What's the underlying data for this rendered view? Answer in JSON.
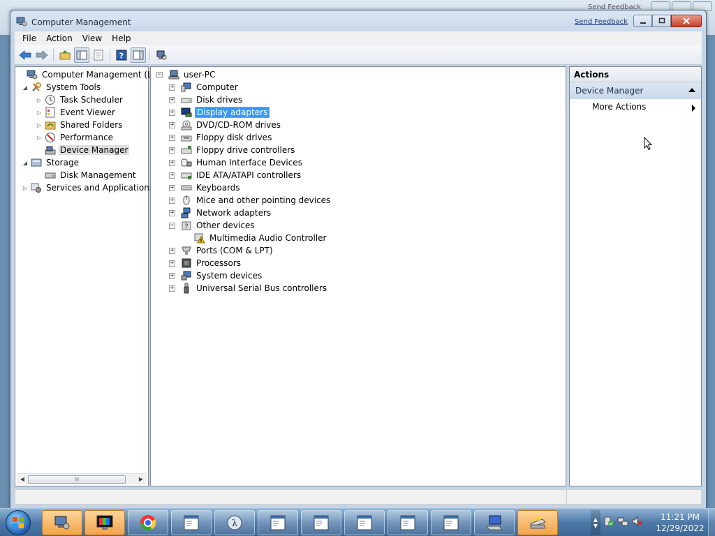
{
  "background_window": {
    "feedback": "Send Feedback"
  },
  "window": {
    "title": "Computer Management",
    "send_feedback": "Send Feedback"
  },
  "menu": [
    "File",
    "Action",
    "View",
    "Help"
  ],
  "left_tree": {
    "root": "Computer Management (Local",
    "system_tools": "System Tools",
    "task_scheduler": "Task Scheduler",
    "event_viewer": "Event Viewer",
    "shared_folders": "Shared Folders",
    "performance": "Performance",
    "device_manager": "Device Manager",
    "storage": "Storage",
    "disk_management": "Disk Management",
    "services": "Services and Applications",
    "scroll_thumb": "III"
  },
  "device_tree": {
    "root": "user-PC",
    "items": [
      "Computer",
      "Disk drives",
      "Display adapters",
      "DVD/CD-ROM drives",
      "Floppy disk drives",
      "Floppy drive controllers",
      "Human Interface Devices",
      "IDE ATA/ATAPI controllers",
      "Keyboards",
      "Mice and other pointing devices",
      "Network adapters",
      "Other devices",
      "Multimedia Audio Controller",
      "Ports (COM & LPT)",
      "Processors",
      "System devices",
      "Universal Serial Bus controllers"
    ]
  },
  "actions": {
    "header": "Actions",
    "section": "Device Manager",
    "more": "More Actions"
  },
  "taskbar": {
    "time": "11:21 PM",
    "date": "12/29/2022"
  },
  "colors": {
    "selection": "#3399ff",
    "taskbar": "#4e79a8",
    "active_task": "#f2a24a"
  }
}
